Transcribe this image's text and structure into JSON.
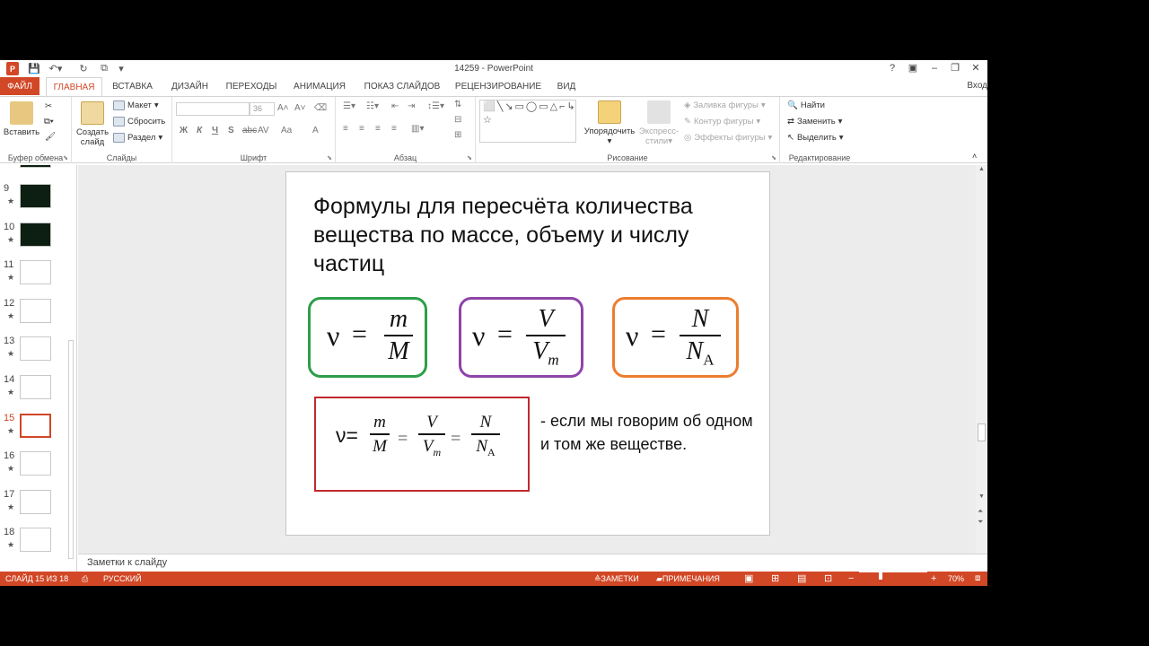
{
  "window": {
    "title": "14259 - PowerPoint",
    "app_letter": "P",
    "help": "?",
    "signin": "Вход"
  },
  "tabs": [
    "ФАЙЛ",
    "ГЛАВНАЯ",
    "ВСТАВКА",
    "ДИЗАЙН",
    "ПЕРЕХОДЫ",
    "АНИМАЦИЯ",
    "ПОКАЗ СЛАЙДОВ",
    "РЕЦЕНЗИРОВАНИЕ",
    "ВИД"
  ],
  "ribbon": {
    "clipboard": {
      "label": "Буфер обмена",
      "paste": "Вставить"
    },
    "slides": {
      "label": "Слайды",
      "new_slide_line1": "Создать",
      "new_slide_line2": "слайд",
      "layout": "Макет",
      "reset": "Сбросить",
      "section": "Раздел"
    },
    "font": {
      "label": "Шрифт",
      "size": "36",
      "bold": "Ж",
      "italic": "К",
      "underline": "Ч",
      "strike": "S",
      "spacing": "AV",
      "case": "Aa",
      "color": "A"
    },
    "paragraph": {
      "label": "Абзац"
    },
    "drawing": {
      "label": "Рисование",
      "shapes_glyphs": "⬜╲↘▭◯▭△⌐↳⇨⇩▱⌒⌒{}☆",
      "arrange": "Упорядочить",
      "quick_styles_line1": "Экспресс-",
      "quick_styles_line2": "стили",
      "fill": "Заливка фигуры",
      "outline": "Контур фигуры",
      "effects": "Эффекты фигуры"
    },
    "editing": {
      "label": "Редактирование",
      "find": "Найти",
      "replace": "Заменить",
      "select": "Выделить"
    }
  },
  "thumbnails": [
    {
      "num": "9",
      "dark": true
    },
    {
      "num": "10",
      "dark": true
    },
    {
      "num": "11",
      "dark": false
    },
    {
      "num": "12",
      "dark": false
    },
    {
      "num": "13",
      "dark": false
    },
    {
      "num": "14",
      "dark": false
    },
    {
      "num": "15",
      "dark": false,
      "current": true
    },
    {
      "num": "16",
      "dark": false
    },
    {
      "num": "17",
      "dark": false
    },
    {
      "num": "18",
      "dark": false
    }
  ],
  "slide": {
    "title": "Формулы для пересчёта количества вещества по массе, объему и числу частиц",
    "nu": "ν",
    "eq": "=",
    "f1": {
      "num": "m",
      "den": "M"
    },
    "f2": {
      "num": "V",
      "den": "V",
      "den_sub": "m"
    },
    "f3": {
      "num": "N",
      "den": "N",
      "den_sub": "A"
    },
    "combined_lead": "ν=",
    "note": "- если мы говорим об одном и том же веществе."
  },
  "notes_placeholder": "Заметки к слайду",
  "status": {
    "slide_info": "СЛАЙД 15 ИЗ 18",
    "language": "РУССКИЙ",
    "notes": "ЗАМЕТКИ",
    "comments": "ПРИМЕЧАНИЯ",
    "zoom_minus": "−",
    "zoom_plus": "+",
    "zoom": "70%"
  },
  "colors": {
    "accent": "#d24726",
    "box_green": "#2e9e49",
    "box_purple": "#8e44a8",
    "box_orange": "#ec7d2f",
    "box_red": "#c0292e"
  }
}
